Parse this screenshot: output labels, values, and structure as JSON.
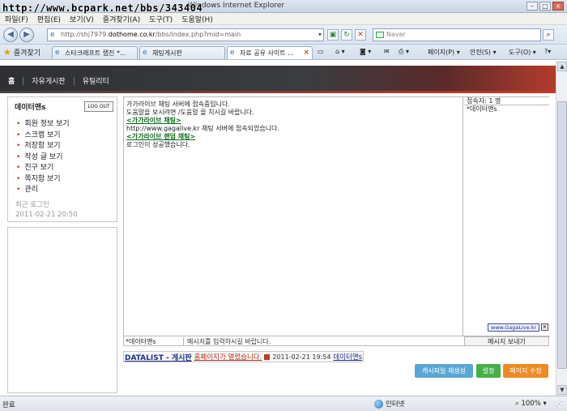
{
  "browser": {
    "title": "Windows Internet Explorer",
    "watermark": "http://www.bcpark.net/bbs/343404",
    "menu": [
      "파일(F)",
      "편집(E)",
      "보기(V)",
      "즐겨찾기(A)",
      "도구(T)",
      "도움말(H)"
    ],
    "url_prefix": "http://shj7979.",
    "url_domain": "dothome.co.kr",
    "url_suffix": "/bbs/index.php?mid=main",
    "search_placeholder": "Naver",
    "favorites_label": "즐겨찾기",
    "tabs": [
      "스타크래프트 랩진 *...",
      "채팅게시판",
      "자료 공유 사이트 ..."
    ],
    "commands": [
      "페이지(P)",
      "안전(S)",
      "도구(O)"
    ]
  },
  "site": {
    "nav": [
      "홈",
      "자유게시판",
      "유틸리티"
    ]
  },
  "user_panel": {
    "username": "데이터맨s",
    "logout_label": "LOG OUT",
    "menu": [
      "회원 정보 보기",
      "스크랩 보기",
      "저장함 보기",
      "작성 글 보기",
      "친구 보기",
      "쪽지함 보기",
      "관리"
    ],
    "last_login_label": "최근 로그인",
    "last_login_time": "2011-02-21 20:50"
  },
  "chat": {
    "lines": [
      {
        "text": "가가라이브 채팅 서버에 접속중입니다.",
        "style": "normal"
      },
      {
        "text": "도움말을 보시려면 /도움말 을 치시길 바랍니다.",
        "style": "normal"
      },
      {
        "text": "<가가라이브 채팅>",
        "style": "highlight"
      },
      {
        "text": "http://www.gagalive.kr 채팅 서버에 접속되었습니다.",
        "style": "normal"
      },
      {
        "text": "<가가라이브 랜덤 채팅>",
        "style": "highlight"
      },
      {
        "text": "로그인이 성공했습니다.",
        "style": "normal"
      }
    ],
    "users_header": "접속자: 1 명",
    "users": [
      "*데이터맨s"
    ],
    "gage_link": "www.GagaLive.kr",
    "gage_close": "x",
    "nickname": "*데이터맨s",
    "message_placeholder": "메시지를 입력하시길 바랍니다.",
    "send_label": "메시지 보내기"
  },
  "info": {
    "board_prefix": "DATALIST - ",
    "board_name": "게시판",
    "notice": "홈페이지가 열렸습니다.",
    "time": "2011-02-21 19:54",
    "user": "데이터맨s"
  },
  "actions": {
    "cache": "캐시파일 재생성",
    "settings": "설정",
    "edit": "페이지 수정"
  },
  "statusbar": {
    "done": "완료",
    "zone": "인터넷",
    "zoom": "100%"
  }
}
